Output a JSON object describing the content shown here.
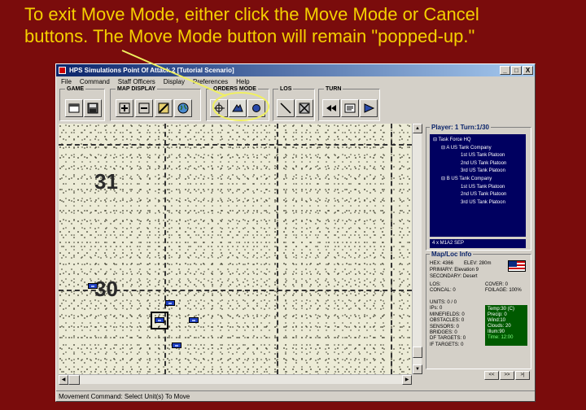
{
  "caption": {
    "line1": "To exit Move Mode, either click the Move Mode or Cancel",
    "line2": "buttons.  The Move Mode button will remain \"popped-up.\""
  },
  "window": {
    "title": "HPS Simulations Point Of Attack 2 [Tutorial Scenario]",
    "buttons": {
      "minimize": "_",
      "maximize": "□",
      "close": "X"
    }
  },
  "menu": [
    "File",
    "Command",
    "Staff Officers",
    "Display",
    "Preferences",
    "Help"
  ],
  "toolbar": {
    "groups": {
      "game": "GAME",
      "map_display": "MAP DISPLAY",
      "orders_mode": "ORDERS MODE",
      "los": "LOS",
      "turn": "TURN"
    }
  },
  "map": {
    "hex_labels": [
      "31",
      "30"
    ]
  },
  "panel": {
    "player_label": "Player: 1  Turn:1/30",
    "tree": {
      "root": "Task Force HQ",
      "companies": [
        {
          "name": "A US Tank Company",
          "platoons": [
            "1st US Tank Platoon",
            "2nd US Tank Platoon",
            "3rd US Tank Platoon"
          ]
        },
        {
          "name": "B US Tank Company",
          "platoons": [
            "1st US Tank Platoon",
            "2nd US Tank Platoon",
            "3rd US Tank Platoon"
          ]
        }
      ]
    },
    "selected_unit": "4 x M1A2 SEP",
    "mapinfo": {
      "header": "Map/Loc Info",
      "hex": "HEX: 4366",
      "elev": "ELEV: 280m",
      "primary": "PRIMARY: Elevation 9",
      "secondary": "SECONDARY: Desert",
      "los": "LOS:",
      "cover": "COVER: 0",
      "concal": "CONCAL: 0",
      "foliage": "FOILAGE: 100%",
      "stats": [
        "UNITS: 0 / 0",
        "IPs: 0",
        "MINEFIELDS: 0",
        "OBSTACLES: 0",
        "SENSORS: 0",
        "BRIDGES: 0",
        "DF TARGETS: 0",
        "IF TARGETS: 0"
      ],
      "weather": [
        "Temp:30 (C)",
        "Precip: 0",
        "Wind:10",
        "Clouds: 20",
        "Illum:90"
      ],
      "time": "Time: 12:00"
    },
    "nav": {
      "prev": "<<",
      "next": ">>",
      "last": ">|"
    }
  },
  "status": "Movement Command: Select Unit(s) To Move",
  "colors": {
    "background": "#7a0c0c",
    "caption": "#f5d000",
    "highlight": "#f0f060"
  }
}
